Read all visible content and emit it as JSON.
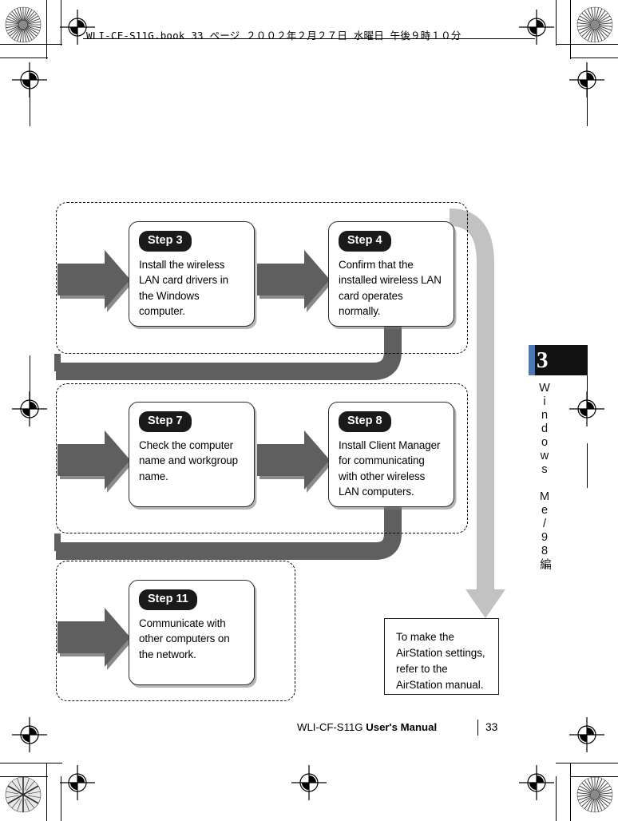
{
  "page": {
    "slug": "WLI-CF-S11G.book   33 ページ   ２００２年２月２７日   水曜日   午後９時１０分",
    "footer_title": "WLI-CF-S11G ",
    "footer_title_bold": "User's Manual",
    "page_number": "33"
  },
  "chapter_tab": {
    "number": "3",
    "title": "Windows Me/98編",
    "tab_color": "#111111",
    "edge_color": "#4a79b8"
  },
  "diagram": {
    "steps": [
      {
        "label": "Step 3",
        "text": "Install the wireless LAN card drivers in the Windows computer."
      },
      {
        "label": "Step 4",
        "text": "Confirm that the installed wireless LAN card operates normally."
      },
      {
        "label": "Step 7",
        "text": "Check the computer name and workgroup name."
      },
      {
        "label": "Step 8",
        "text": "Install Client Manager for communicating with other wireless LAN computers."
      },
      {
        "label": "Step 11",
        "text": "Communicate with other computers on the network."
      }
    ],
    "note": {
      "text": "To make the AirStation settings, refer to the AirStation manual."
    },
    "colors": {
      "arrow_dark": "#5f5f5f",
      "arrow_light": "#c2c2c2",
      "connector": "#5f5f5f",
      "step_label_bg": "#1a1a1a",
      "border": "#2b2b2b"
    }
  }
}
